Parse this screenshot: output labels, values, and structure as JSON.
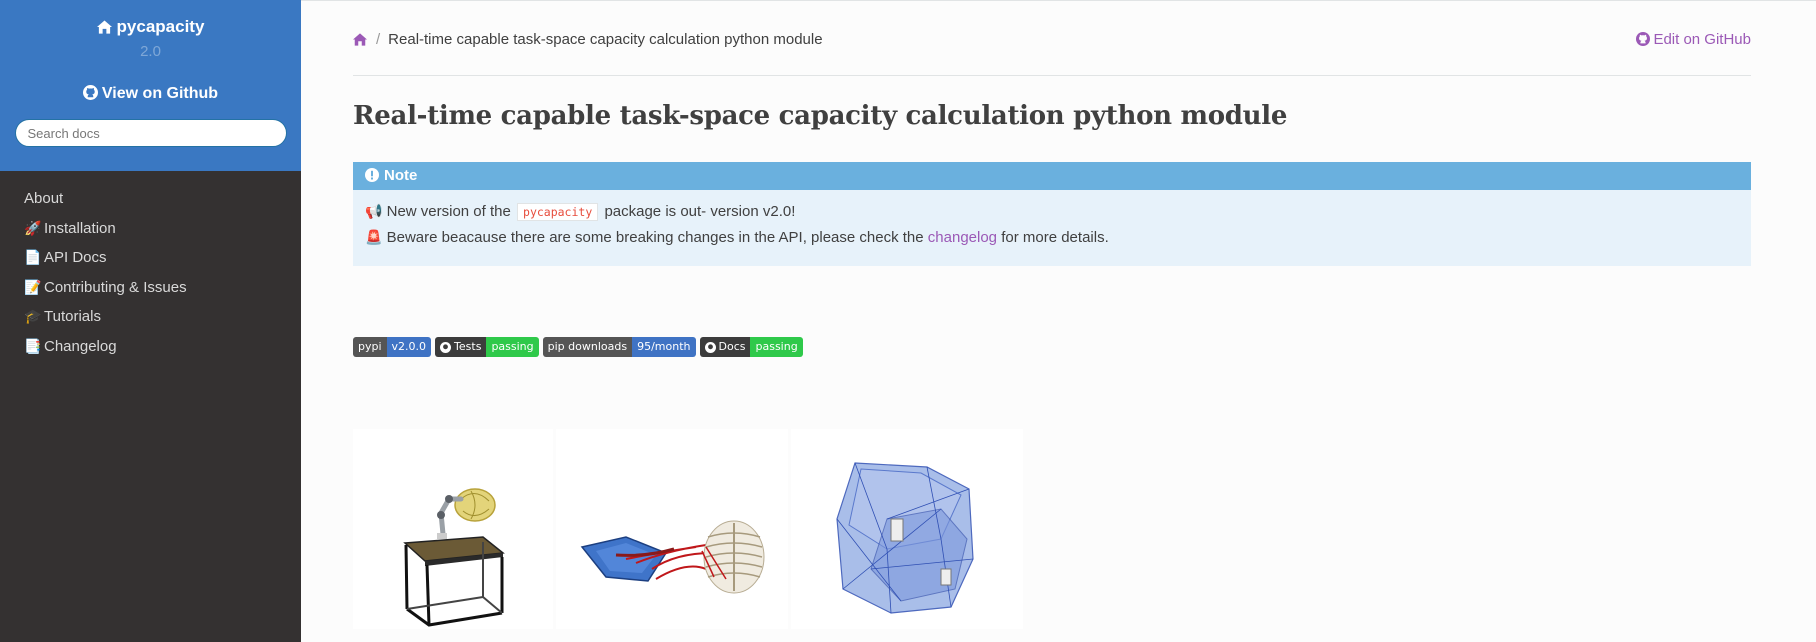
{
  "sidebar": {
    "project_name": "pycapacity",
    "version": "2.0",
    "view_github_label": "View on Github",
    "search_placeholder": "Search docs",
    "nav": [
      {
        "emoji": "",
        "label": "About"
      },
      {
        "emoji": "🚀",
        "label": "Installation"
      },
      {
        "emoji": "📄",
        "label": "API Docs"
      },
      {
        "emoji": "📝",
        "label": "Contributing & Issues"
      },
      {
        "emoji": "🎓",
        "label": "Tutorials"
      },
      {
        "emoji": "📑",
        "label": "Changelog"
      }
    ],
    "colors": {
      "top": "#3a78c2",
      "menu": "#343131"
    }
  },
  "breadcrumb": {
    "home_icon": "home-icon",
    "current": "Real-time capable task-space capacity calculation python module",
    "edit_label": "Edit on GitHub"
  },
  "page": {
    "title": "Real-time capable task-space capacity calculation python module"
  },
  "note": {
    "heading": "Note",
    "line1_emoji": "📢",
    "line1_before": "New version of the",
    "line1_code": "pycapacity",
    "line1_after": "package is out- version v2.0!",
    "line2_emoji": "🚨",
    "line2_before": "Beware beacause there are some breaking changes in the API, please check the",
    "line2_link": "changelog",
    "line2_after": "for more details."
  },
  "badges": [
    {
      "left": "pypi",
      "right": "v2.0.0",
      "color": "#3f73c4",
      "icon": ""
    },
    {
      "left": "Tests",
      "right": "passing",
      "color": "#2fc94a",
      "icon": "github-icon"
    },
    {
      "left": "pip downloads",
      "right": "95/month",
      "color": "#3f73c4",
      "icon": ""
    },
    {
      "left": "Docs",
      "right": "passing",
      "color": "#2fc94a",
      "icon": "github-icon"
    }
  ],
  "images": [
    {
      "name": "robot-arm-table-image"
    },
    {
      "name": "human-arm-muscles-image"
    },
    {
      "name": "capacity-polytope-image"
    }
  ]
}
